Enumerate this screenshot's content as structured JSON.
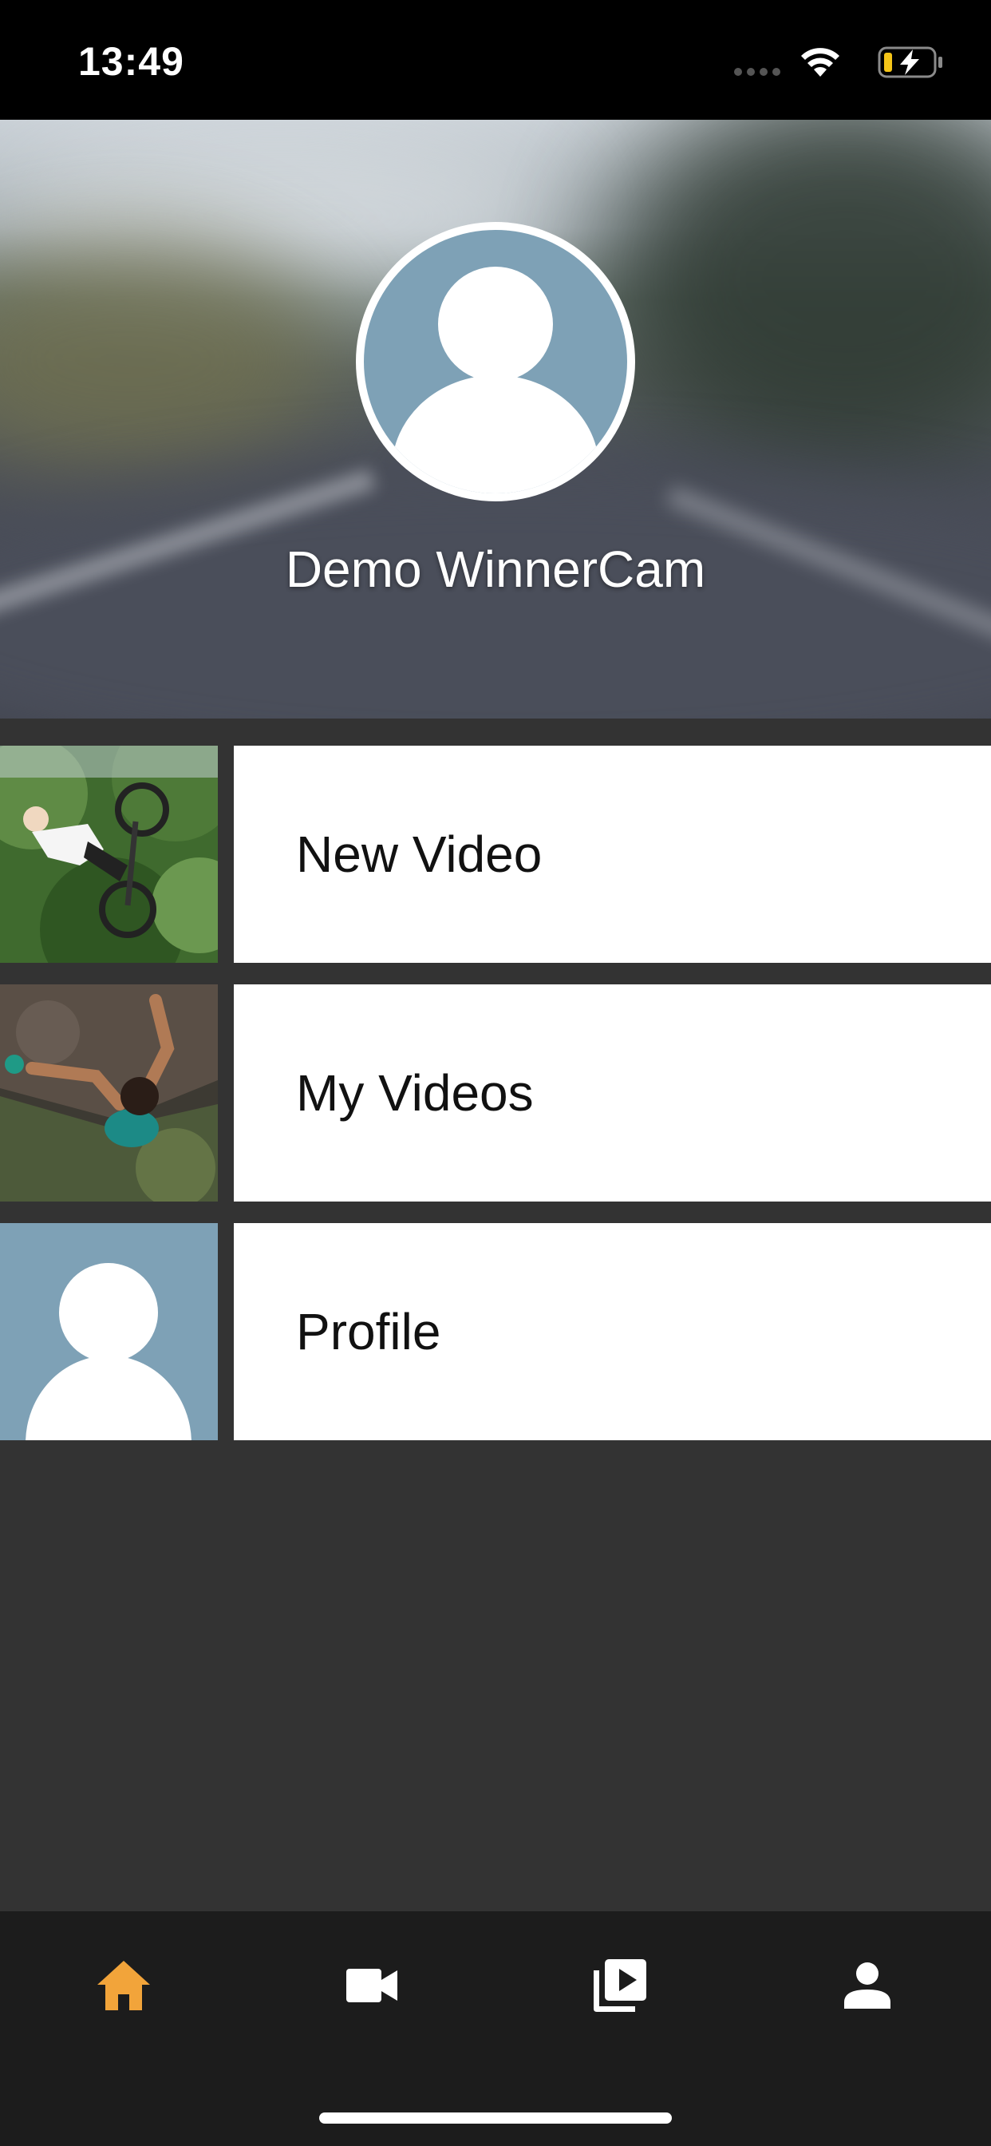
{
  "status_bar": {
    "time": "13:49",
    "signal_icon": "signal-dots-icon",
    "wifi_icon": "wifi-icon",
    "battery_icon": "battery-charging-icon",
    "battery_accent": "#f5c518"
  },
  "profile": {
    "display_name": "Demo WinnerCam",
    "avatar_icon": "person-placeholder-icon",
    "avatar_bg": "#7ea1b6"
  },
  "menu": {
    "items": [
      {
        "label": "New Video",
        "thumb": "bmx-rider-photo"
      },
      {
        "label": "My Videos",
        "thumb": "rock-climber-photo"
      },
      {
        "label": "Profile",
        "thumb": "person-placeholder-icon"
      }
    ]
  },
  "tab_bar": {
    "active_color": "#f2a43a",
    "inactive_color": "#ffffff",
    "tabs": [
      {
        "icon": "home-icon",
        "active": true
      },
      {
        "icon": "video-camera-icon",
        "active": false
      },
      {
        "icon": "video-library-icon",
        "active": false
      },
      {
        "icon": "person-icon",
        "active": false
      }
    ]
  }
}
